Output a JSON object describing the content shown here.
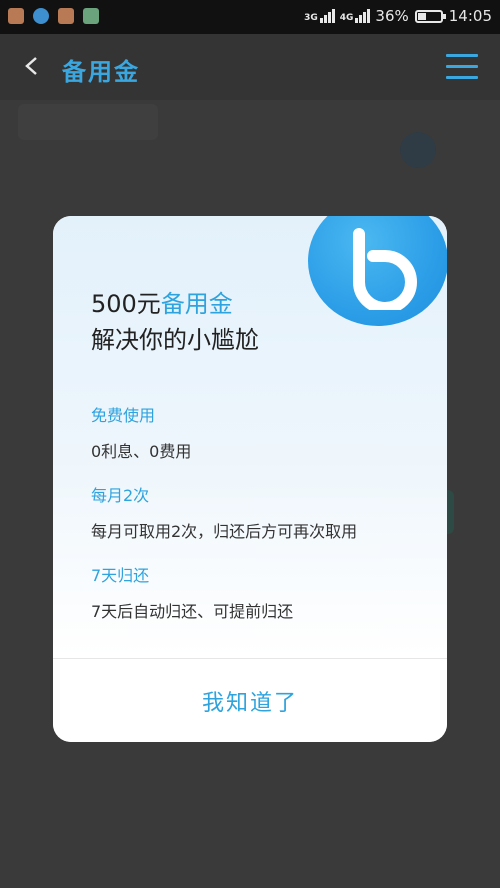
{
  "status_bar": {
    "network_1": "3G",
    "network_2": "4G",
    "battery_text": "36%",
    "battery_level": 0.36,
    "time": "14:05"
  },
  "header": {
    "title": "备用金",
    "back_icon": "chevron-left-icon",
    "menu_icon": "hamburger-menu-icon"
  },
  "modal": {
    "headline_amount": "500元",
    "headline_accent": "备用金",
    "headline_line2": "解决你的小尴尬",
    "logo_icon": "b-logo-icon",
    "features": [
      {
        "title": "免费使用",
        "desc": "0利息、0费用"
      },
      {
        "title": "每月2次",
        "desc": "每月可取用2次，归还后方可再次取用"
      },
      {
        "title": "7天归还",
        "desc": "7天后自动归还、可提前归还"
      }
    ],
    "confirm_label": "我知道了"
  },
  "colors": {
    "accent": "#2ea3de",
    "header_bg": "#343434",
    "overlay_bg": "#3a3a3a"
  }
}
